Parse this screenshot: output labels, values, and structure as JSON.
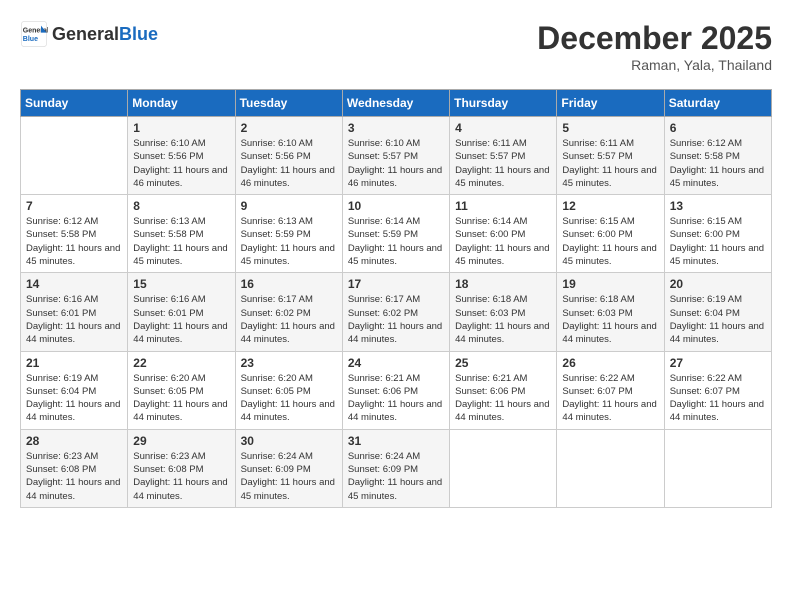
{
  "header": {
    "logo_general": "General",
    "logo_blue": "Blue",
    "month": "December 2025",
    "location": "Raman, Yala, Thailand"
  },
  "days_of_week": [
    "Sunday",
    "Monday",
    "Tuesday",
    "Wednesday",
    "Thursday",
    "Friday",
    "Saturday"
  ],
  "weeks": [
    [
      {
        "day": "",
        "info": ""
      },
      {
        "day": "1",
        "info": "Sunrise: 6:10 AM\nSunset: 5:56 PM\nDaylight: 11 hours and 46 minutes."
      },
      {
        "day": "2",
        "info": "Sunrise: 6:10 AM\nSunset: 5:56 PM\nDaylight: 11 hours and 46 minutes."
      },
      {
        "day": "3",
        "info": "Sunrise: 6:10 AM\nSunset: 5:57 PM\nDaylight: 11 hours and 46 minutes."
      },
      {
        "day": "4",
        "info": "Sunrise: 6:11 AM\nSunset: 5:57 PM\nDaylight: 11 hours and 45 minutes."
      },
      {
        "day": "5",
        "info": "Sunrise: 6:11 AM\nSunset: 5:57 PM\nDaylight: 11 hours and 45 minutes."
      },
      {
        "day": "6",
        "info": "Sunrise: 6:12 AM\nSunset: 5:58 PM\nDaylight: 11 hours and 45 minutes."
      }
    ],
    [
      {
        "day": "7",
        "info": "Sunrise: 6:12 AM\nSunset: 5:58 PM\nDaylight: 11 hours and 45 minutes."
      },
      {
        "day": "8",
        "info": "Sunrise: 6:13 AM\nSunset: 5:58 PM\nDaylight: 11 hours and 45 minutes."
      },
      {
        "day": "9",
        "info": "Sunrise: 6:13 AM\nSunset: 5:59 PM\nDaylight: 11 hours and 45 minutes."
      },
      {
        "day": "10",
        "info": "Sunrise: 6:14 AM\nSunset: 5:59 PM\nDaylight: 11 hours and 45 minutes."
      },
      {
        "day": "11",
        "info": "Sunrise: 6:14 AM\nSunset: 6:00 PM\nDaylight: 11 hours and 45 minutes."
      },
      {
        "day": "12",
        "info": "Sunrise: 6:15 AM\nSunset: 6:00 PM\nDaylight: 11 hours and 45 minutes."
      },
      {
        "day": "13",
        "info": "Sunrise: 6:15 AM\nSunset: 6:00 PM\nDaylight: 11 hours and 45 minutes."
      }
    ],
    [
      {
        "day": "14",
        "info": "Sunrise: 6:16 AM\nSunset: 6:01 PM\nDaylight: 11 hours and 44 minutes."
      },
      {
        "day": "15",
        "info": "Sunrise: 6:16 AM\nSunset: 6:01 PM\nDaylight: 11 hours and 44 minutes."
      },
      {
        "day": "16",
        "info": "Sunrise: 6:17 AM\nSunset: 6:02 PM\nDaylight: 11 hours and 44 minutes."
      },
      {
        "day": "17",
        "info": "Sunrise: 6:17 AM\nSunset: 6:02 PM\nDaylight: 11 hours and 44 minutes."
      },
      {
        "day": "18",
        "info": "Sunrise: 6:18 AM\nSunset: 6:03 PM\nDaylight: 11 hours and 44 minutes."
      },
      {
        "day": "19",
        "info": "Sunrise: 6:18 AM\nSunset: 6:03 PM\nDaylight: 11 hours and 44 minutes."
      },
      {
        "day": "20",
        "info": "Sunrise: 6:19 AM\nSunset: 6:04 PM\nDaylight: 11 hours and 44 minutes."
      }
    ],
    [
      {
        "day": "21",
        "info": "Sunrise: 6:19 AM\nSunset: 6:04 PM\nDaylight: 11 hours and 44 minutes."
      },
      {
        "day": "22",
        "info": "Sunrise: 6:20 AM\nSunset: 6:05 PM\nDaylight: 11 hours and 44 minutes."
      },
      {
        "day": "23",
        "info": "Sunrise: 6:20 AM\nSunset: 6:05 PM\nDaylight: 11 hours and 44 minutes."
      },
      {
        "day": "24",
        "info": "Sunrise: 6:21 AM\nSunset: 6:06 PM\nDaylight: 11 hours and 44 minutes."
      },
      {
        "day": "25",
        "info": "Sunrise: 6:21 AM\nSunset: 6:06 PM\nDaylight: 11 hours and 44 minutes."
      },
      {
        "day": "26",
        "info": "Sunrise: 6:22 AM\nSunset: 6:07 PM\nDaylight: 11 hours and 44 minutes."
      },
      {
        "day": "27",
        "info": "Sunrise: 6:22 AM\nSunset: 6:07 PM\nDaylight: 11 hours and 44 minutes."
      }
    ],
    [
      {
        "day": "28",
        "info": "Sunrise: 6:23 AM\nSunset: 6:08 PM\nDaylight: 11 hours and 44 minutes."
      },
      {
        "day": "29",
        "info": "Sunrise: 6:23 AM\nSunset: 6:08 PM\nDaylight: 11 hours and 44 minutes."
      },
      {
        "day": "30",
        "info": "Sunrise: 6:24 AM\nSunset: 6:09 PM\nDaylight: 11 hours and 45 minutes."
      },
      {
        "day": "31",
        "info": "Sunrise: 6:24 AM\nSunset: 6:09 PM\nDaylight: 11 hours and 45 minutes."
      },
      {
        "day": "",
        "info": ""
      },
      {
        "day": "",
        "info": ""
      },
      {
        "day": "",
        "info": ""
      }
    ]
  ]
}
